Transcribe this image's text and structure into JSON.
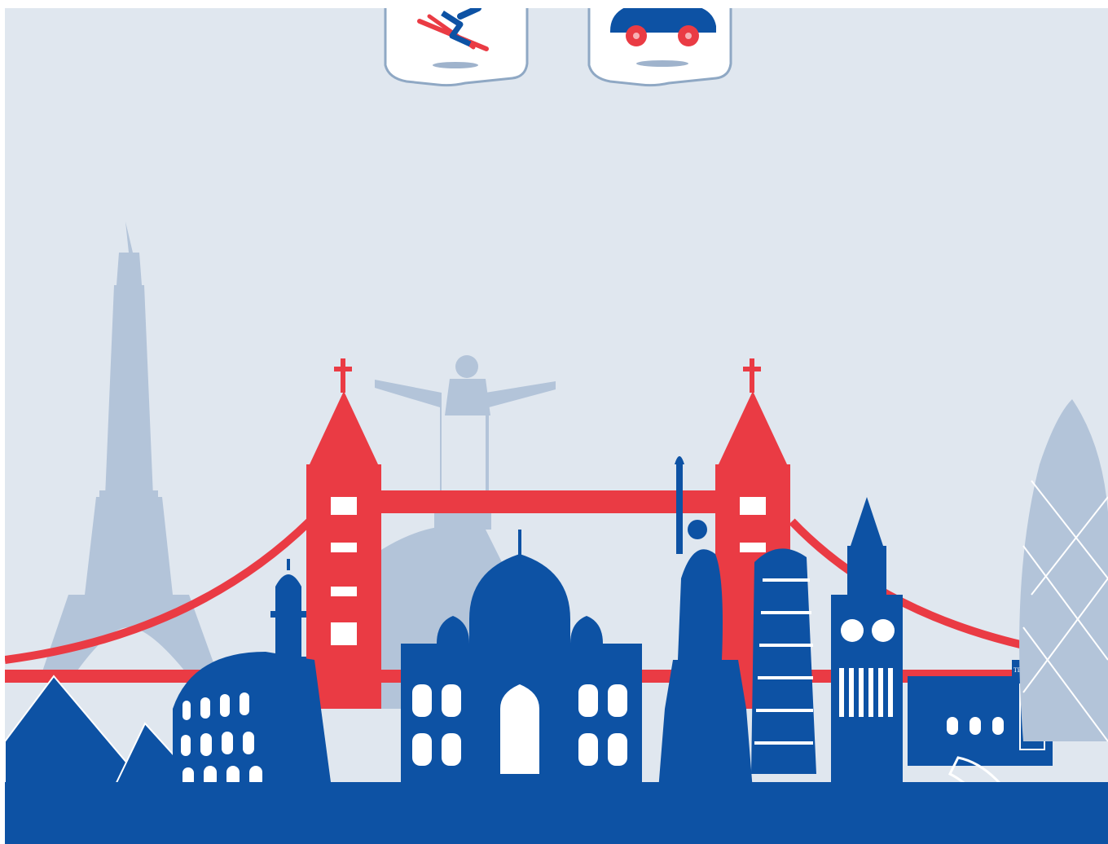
{
  "colors": {
    "background": "#e0e7ef",
    "blue": "#0d52a4",
    "red": "#ea3b44",
    "pale": "#b3c4d9",
    "tile_border": "#8fa8c4"
  },
  "categories": [
    {
      "icon": "skier-icon"
    },
    {
      "icon": "car-icon"
    }
  ],
  "scene": {
    "landmarks": [
      "eiffel-tower",
      "christ-the-redeemer",
      "tower-bridge",
      "pyramids",
      "colosseum",
      "minaret",
      "taj-mahal",
      "statue-of-liberty",
      "leaning-tower-of-pisa",
      "big-ben",
      "great-wall",
      "telephone-box",
      "gherkin"
    ],
    "telephone_sign": "TELEPHONE"
  }
}
